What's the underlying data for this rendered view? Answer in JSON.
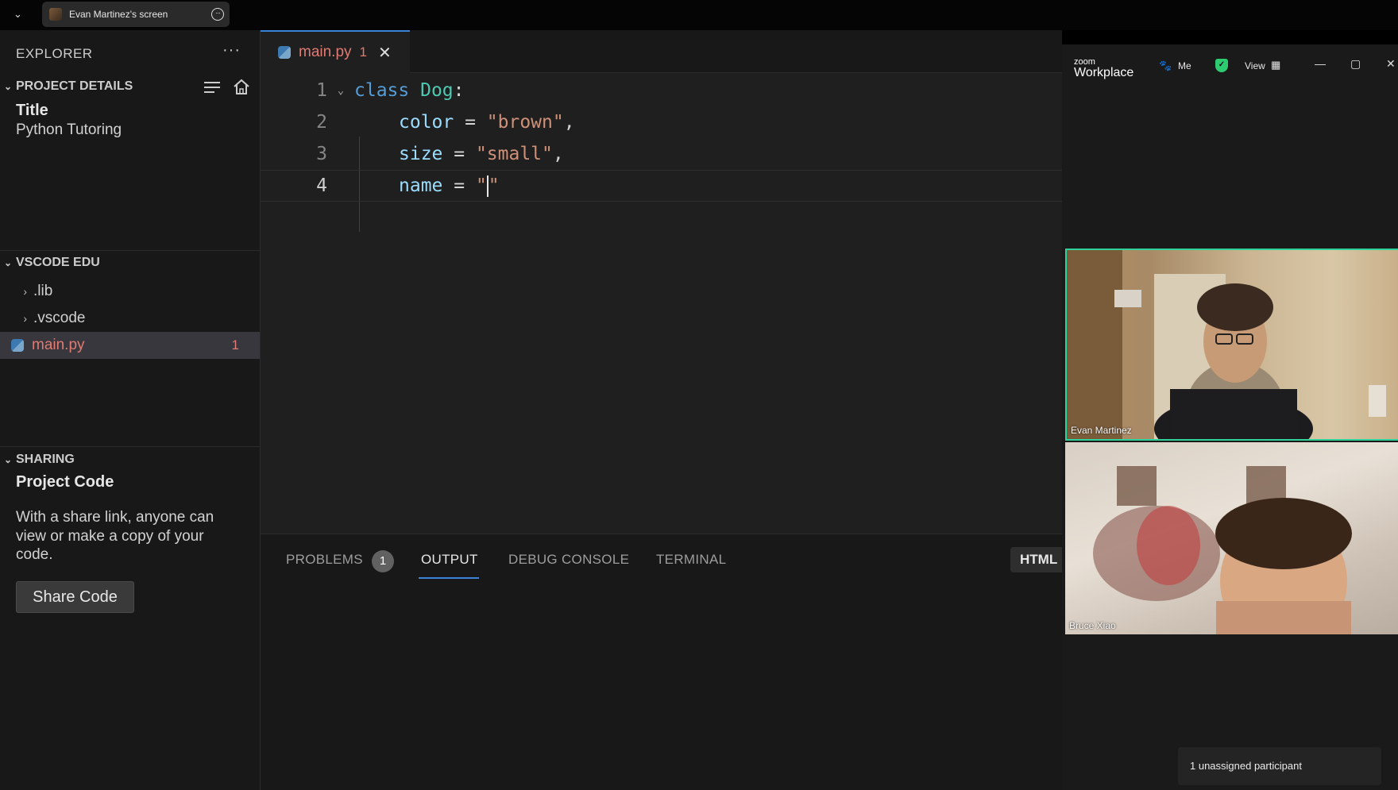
{
  "share_bar": {
    "title": "Evan Martinez's screen",
    "caret_icon": "chevron-down-icon",
    "more_icon": "more-options-icon"
  },
  "sidebar": {
    "header": "EXPLORER",
    "more": "···",
    "project_details": {
      "title": "PROJECT DETAILS",
      "field_label": "Title",
      "field_value": "Python Tutoring"
    },
    "vscode_edu": {
      "title": "VSCODE EDU",
      "items": [
        {
          "label": ".lib",
          "type": "folder"
        },
        {
          "label": ".vscode",
          "type": "folder"
        },
        {
          "label": "main.py",
          "type": "file",
          "problems": "1",
          "active": true
        }
      ]
    },
    "sharing": {
      "title": "SHARING",
      "heading": "Project Code",
      "description_lines": [
        "With a share link, anyone can",
        "view or make a copy of your",
        "code."
      ],
      "button": "Share Code"
    }
  },
  "editor": {
    "tab": {
      "name": "main.py",
      "problems": "1"
    },
    "line_numbers": [
      "1",
      "2",
      "3",
      "4"
    ],
    "lines": {
      "l1": {
        "kw": "class",
        "cls": "Dog",
        "punct": ":"
      },
      "l2": {
        "id": "color",
        "op": " = ",
        "str": "\"brown\"",
        "punct": ","
      },
      "l3": {
        "id": "size",
        "op": " = ",
        "str": "\"small\"",
        "punct": ","
      },
      "l4": {
        "id": "name",
        "op": " = ",
        "str_open": "\"",
        "str_close": "\""
      }
    }
  },
  "panel": {
    "tabs": [
      "PROBLEMS",
      "OUTPUT",
      "DEBUG CONSOLE",
      "TERMINAL"
    ],
    "active_tab": "OUTPUT",
    "problems_badge": "1",
    "language_chip": "HTML"
  },
  "zoom": {
    "logo_small": "zoom",
    "logo_big": "Workplace",
    "meeting_label": "Me",
    "view_label": "View",
    "participants": [
      {
        "name": "Evan Martinez",
        "active_speaker": true
      },
      {
        "name": "Bruce Xiao",
        "active_speaker": false
      }
    ],
    "notice": "1 unassigned participant",
    "colors": {
      "active_speaker_border": "#2fd39a",
      "shield": "#2ecc71"
    }
  }
}
